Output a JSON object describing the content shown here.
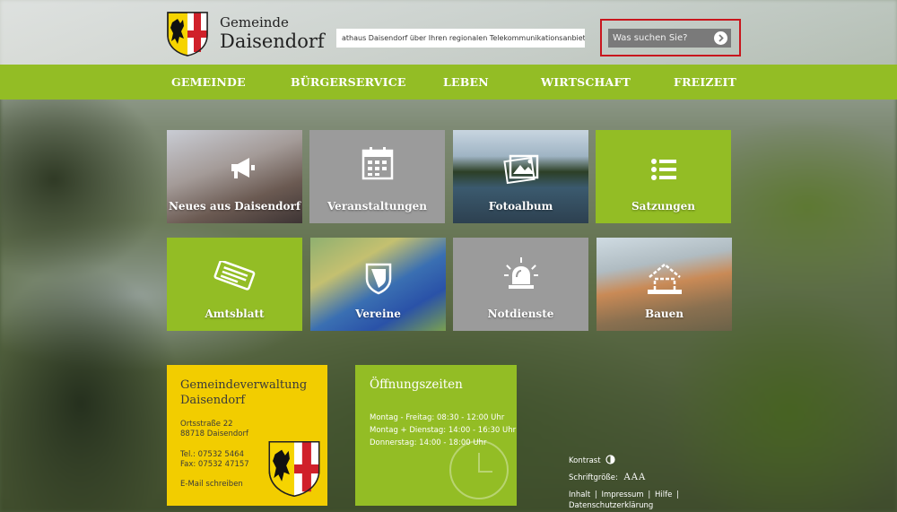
{
  "header": {
    "brand_small": "Gemeinde",
    "brand_big": "Daisendorf",
    "ticker": "athaus Daisendorf über Ihren regionalen Telekommunikationsanbieter TeleDa",
    "search_placeholder": "Was suchen Sie?"
  },
  "nav": [
    "GEMEINDE",
    "BÜRGERSERVICE",
    "LEBEN",
    "WIRTSCHAFT",
    "FREIZEIT"
  ],
  "tiles": [
    {
      "label": "Neues aus Daisendorf",
      "icon": "megaphone-icon"
    },
    {
      "label": "Veranstaltungen",
      "icon": "calendar-icon"
    },
    {
      "label": "Fotoalbum",
      "icon": "photo-icon"
    },
    {
      "label": "Satzungen",
      "icon": "list-icon"
    },
    {
      "label": "Amtsblatt",
      "icon": "newspaper-icon"
    },
    {
      "label": "Vereine",
      "icon": "shield-icon"
    },
    {
      "label": "Notdienste",
      "icon": "siren-icon"
    },
    {
      "label": "Bauen",
      "icon": "house-icon"
    }
  ],
  "admin": {
    "title_line1": "Gemeindeverwaltung",
    "title_line2": "Daisendorf",
    "street": "Ortsstraße 22",
    "city": "88718 Daisendorf",
    "tel": "Tel.: 07532 5464",
    "fax": "Fax: 07532 47157",
    "email_link": "E-Mail schreiben"
  },
  "hours": {
    "title": "Öffnungszeiten",
    "line1": "Montag - Freitag: 08:30 - 12:00 Uhr",
    "line2": "Montag + Dienstag: 14:00 - 16:30 Uhr",
    "line3": "Donnerstag: 14:00 - 18:00 Uhr"
  },
  "tools": {
    "contrast": "Kontrast",
    "fontsize": "Schriftgröße:",
    "fontsize_options": "AAA",
    "links": [
      "Inhalt",
      "Impressum",
      "Hilfe",
      "Datenschutzerklärung"
    ],
    "separator": "|"
  },
  "colors": {
    "accent_green": "#93bd25",
    "tile_grey": "#9b9b9b",
    "admin_yellow": "#f2cd00",
    "highlight_red": "#c8161d"
  }
}
